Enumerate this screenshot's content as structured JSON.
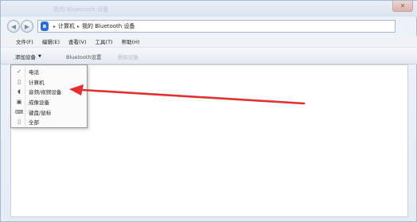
{
  "titlebar": {
    "faint_title": "我的 Bluetooth 设备",
    "close_glyph": "✕"
  },
  "nav": {
    "back_glyph": "◀",
    "forward_glyph": "▶"
  },
  "address": {
    "icon_label": "ʙ",
    "crumbs": [
      "计算机",
      "我的 Bluetooth 设备"
    ],
    "separator": "▸"
  },
  "menubar": {
    "items": [
      "文件(F)",
      "编辑(E)",
      "查看(V)",
      "工具(T)",
      "帮助(H)"
    ]
  },
  "toolbar": {
    "add_label": "添加设备",
    "add_caret": "▼",
    "bluetooth_label": "Bluetooth设置",
    "disabled_label": "删除设备"
  },
  "dropdown": {
    "items": [
      {
        "label": "电话",
        "icon": "phone-icon",
        "glyph": "✓"
      },
      {
        "label": "计算机",
        "icon": "computer-icon",
        "glyph": "▯"
      },
      {
        "label": "音频/视频设备",
        "icon": "headphones-icon",
        "glyph": "◖"
      },
      {
        "label": "成像设备",
        "icon": "camera-icon",
        "glyph": "▣"
      },
      {
        "label": "键盘/鼠标",
        "icon": "keyboard-icon",
        "glyph": "⌨"
      },
      {
        "label": "全部",
        "icon": "all-devices-icon",
        "glyph": "▯"
      }
    ]
  },
  "colors": {
    "arrow": "#e03030",
    "bluetooth_icon": "#2a6fd6"
  }
}
